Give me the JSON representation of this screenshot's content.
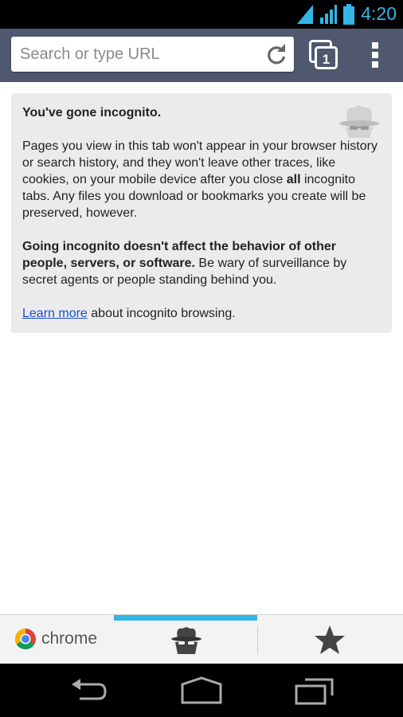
{
  "status_bar": {
    "time": "4:20",
    "icons": [
      "wifi-icon",
      "signal-icon",
      "battery-icon"
    ]
  },
  "toolbar": {
    "search_placeholder": "Search or type URL",
    "tab_count": "1"
  },
  "incognito_card": {
    "title": "You've gone incognito.",
    "para1_a": "Pages you view in this tab won't appear in your browser history or search history, and they won't leave other traces, like cookies, on your mobile device after you close ",
    "para1_bold": "all",
    "para1_b": " incognito tabs. Any files you download or bookmarks you create will be preserved, however.",
    "para2_bold": "Going incognito doesn't affect the behavior of other people, servers, or software.",
    "para2_rest": " Be wary of surveillance by secret agents or people standing behind you.",
    "learn_more_link": "Learn more",
    "learn_more_rest": " about incognito browsing."
  },
  "bottom_bar": {
    "brand_label": "chrome"
  },
  "colors": {
    "accent": "#33b5e5",
    "toolbar": "#4f586f",
    "card_bg": "#ebebeb",
    "link": "#1a4ed8"
  }
}
